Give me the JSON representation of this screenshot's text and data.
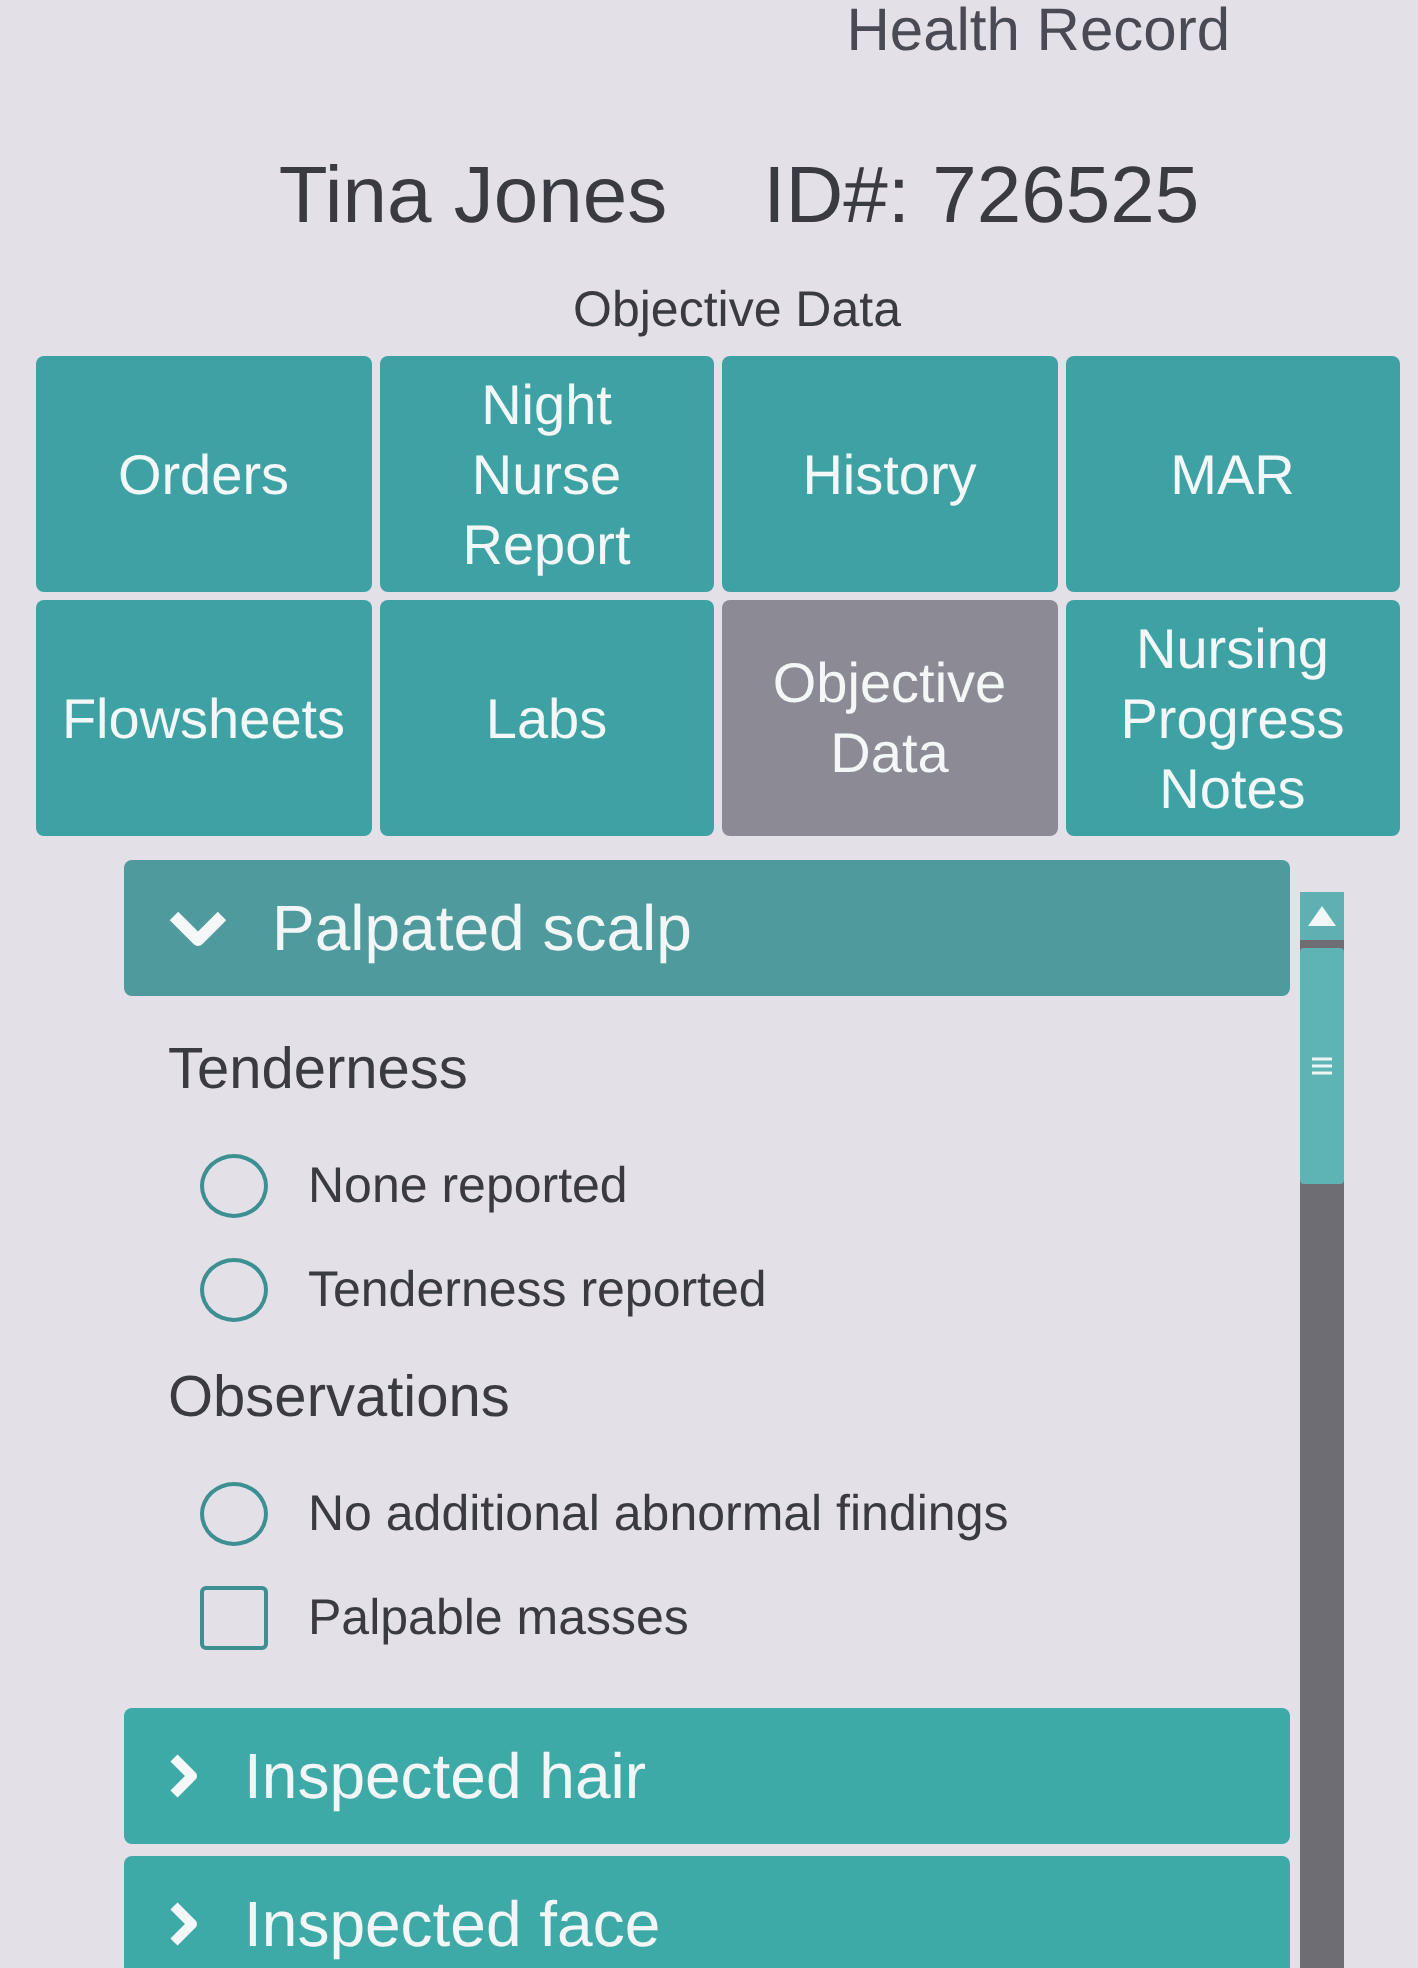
{
  "header": {
    "title": "Health Record",
    "patient_name": "Tina Jones",
    "patient_id": "ID#: 726525",
    "page_title": "Objective Data"
  },
  "tabs": [
    {
      "label": "Orders",
      "selected": false
    },
    {
      "label": "Night Nurse Report",
      "selected": false
    },
    {
      "label": "History",
      "selected": false
    },
    {
      "label": "MAR",
      "selected": false
    },
    {
      "label": "Flowsheets",
      "selected": false
    },
    {
      "label": "Labs",
      "selected": false
    },
    {
      "label": "Objective Data",
      "selected": true
    },
    {
      "label": "Nursing Progress Notes",
      "selected": false
    }
  ],
  "sections": [
    {
      "title": "Palpated scalp",
      "expanded": true,
      "groups": [
        {
          "label": "Tenderness",
          "options": [
            {
              "kind": "radio",
              "label": "None reported",
              "checked": false
            },
            {
              "kind": "radio",
              "label": "Tenderness reported",
              "checked": false
            }
          ]
        },
        {
          "label": "Observations",
          "options": [
            {
              "kind": "radio",
              "label": "No additional abnormal findings",
              "checked": false
            },
            {
              "kind": "checkbox",
              "label": "Palpable masses",
              "checked": false
            }
          ]
        }
      ]
    },
    {
      "title": "Inspected hair",
      "expanded": false
    },
    {
      "title": "Inspected face",
      "expanded": false
    }
  ]
}
